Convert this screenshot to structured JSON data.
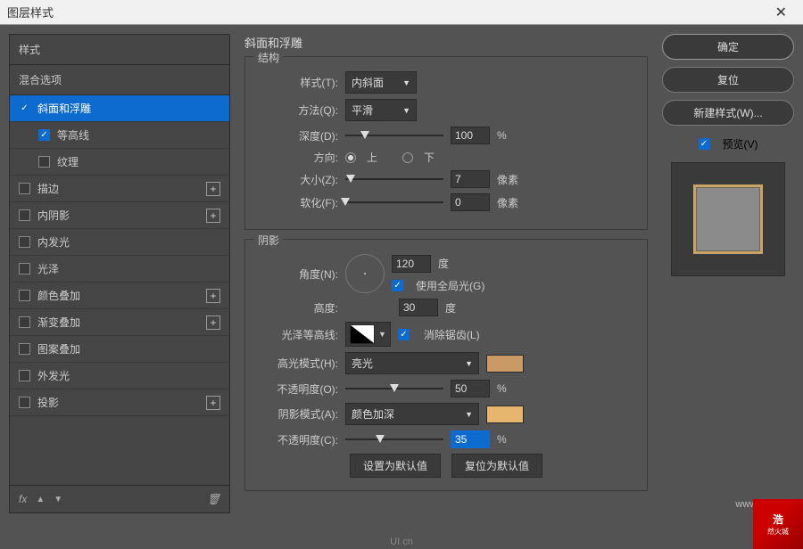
{
  "titlebar": {
    "title": "图层样式",
    "close": "✕"
  },
  "left": {
    "header": "样式",
    "subheader": "混合选项",
    "items": [
      {
        "label": "斜面和浮雕",
        "checked": true,
        "selected": true,
        "plus": false
      },
      {
        "label": "等高线",
        "checked": true,
        "sub": true
      },
      {
        "label": "纹理",
        "checked": false,
        "sub": true
      },
      {
        "label": "描边",
        "checked": false,
        "plus": true
      },
      {
        "label": "内阴影",
        "checked": false,
        "plus": true
      },
      {
        "label": "内发光",
        "checked": false
      },
      {
        "label": "光泽",
        "checked": false
      },
      {
        "label": "颜色叠加",
        "checked": false,
        "plus": true
      },
      {
        "label": "渐变叠加",
        "checked": false,
        "plus": true
      },
      {
        "label": "图案叠加",
        "checked": false
      },
      {
        "label": "外发光",
        "checked": false
      },
      {
        "label": "投影",
        "checked": false,
        "plus": true
      }
    ],
    "fx": "fx"
  },
  "center": {
    "title": "斜面和浮雕",
    "structure": {
      "legend": "结构",
      "style_lbl": "样式(T):",
      "style_val": "内斜面",
      "technique_lbl": "方法(Q):",
      "technique_val": "平滑",
      "depth_lbl": "深度(D):",
      "depth_val": "100",
      "depth_unit": "%",
      "direction_lbl": "方向:",
      "up": "上",
      "down": "下",
      "size_lbl": "大小(Z):",
      "size_val": "7",
      "size_unit": "像素",
      "soften_lbl": "软化(F):",
      "soften_val": "0",
      "soften_unit": "像素"
    },
    "shading": {
      "legend": "阴影",
      "angle_lbl": "角度(N):",
      "angle_val": "120",
      "angle_unit": "度",
      "global_light": "使用全局光(G)",
      "altitude_lbl": "高度:",
      "altitude_val": "30",
      "altitude_unit": "度",
      "gloss_lbl": "光泽等高线:",
      "antialias": "消除锯齿(L)",
      "highlight_mode_lbl": "高光模式(H):",
      "highlight_mode_val": "亮光",
      "highlight_opacity_lbl": "不透明度(O):",
      "highlight_opacity_val": "50",
      "highlight_opacity_unit": "%",
      "shadow_mode_lbl": "阴影模式(A):",
      "shadow_mode_val": "颜色加深",
      "shadow_opacity_lbl": "不透明度(C):",
      "shadow_opacity_val": "35",
      "shadow_opacity_unit": "%",
      "highlight_color": "#c99a66",
      "shadow_color": "#e6b66e"
    },
    "buttons": {
      "default": "设置为默认值",
      "reset": "复位为默认值"
    }
  },
  "right": {
    "ok": "确定",
    "cancel": "复位",
    "new_style": "新建样式(W)...",
    "preview": "预览(V)"
  },
  "watermark": "www.hryckj.cn",
  "bottom_logo": "UI cn",
  "corner": {
    "big": "浩",
    "sub": "然火城"
  }
}
